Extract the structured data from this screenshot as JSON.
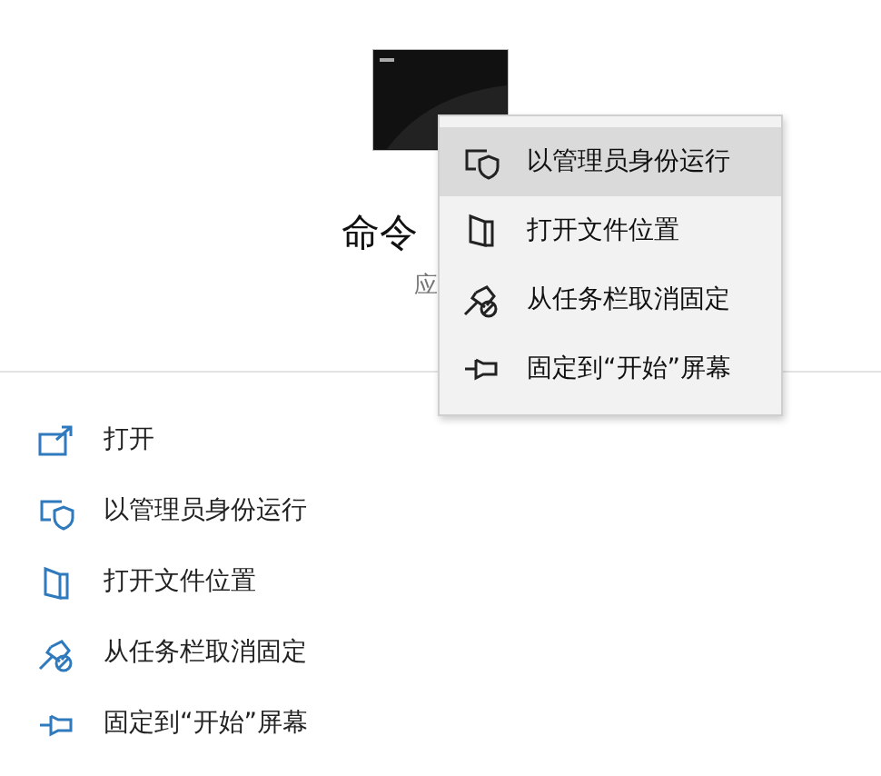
{
  "app": {
    "title": "命令",
    "subtitle": "应"
  },
  "actions": [
    {
      "label": "打开",
      "kind": "open"
    },
    {
      "label": "以管理员身份运行",
      "kind": "admin"
    },
    {
      "label": "打开文件位置",
      "kind": "folder"
    },
    {
      "label": "从任务栏取消固定",
      "kind": "unpin"
    },
    {
      "label": "固定到“开始”屏幕",
      "kind": "pin"
    }
  ],
  "context_menu": [
    {
      "label": "以管理员身份运行",
      "kind": "admin",
      "selected": true
    },
    {
      "label": "打开文件位置",
      "kind": "folder",
      "selected": false
    },
    {
      "label": "从任务栏取消固定",
      "kind": "unpin",
      "selected": false
    },
    {
      "label": "固定到“开始”屏幕",
      "kind": "pin",
      "selected": false
    }
  ]
}
